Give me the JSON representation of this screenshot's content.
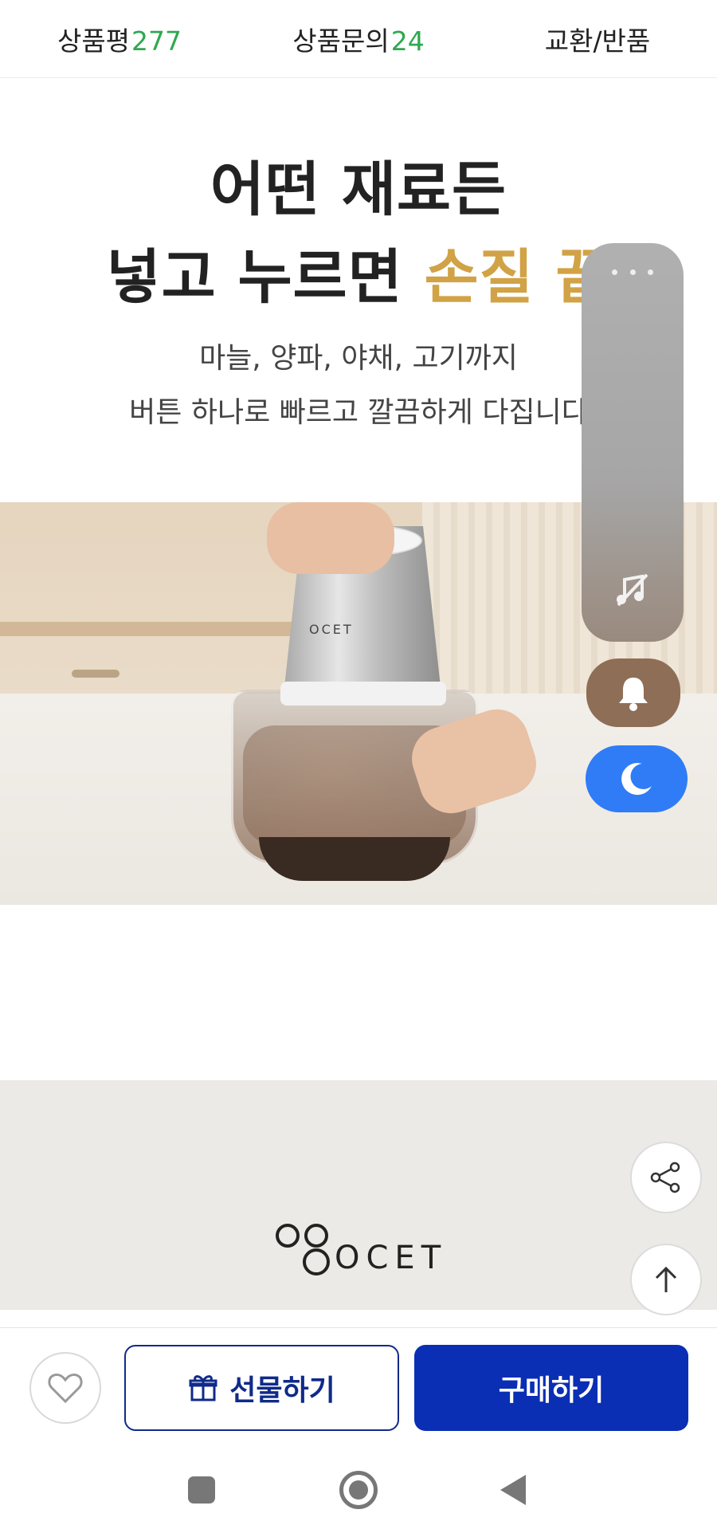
{
  "tabs": [
    {
      "label": "상품평",
      "count": "277"
    },
    {
      "label": "상품문의",
      "count": "24"
    },
    {
      "label": "교환/반품",
      "count": ""
    }
  ],
  "hero": {
    "headline_line1": "어떤 재료든",
    "headline_line2_prefix": "넣고 누르면 ",
    "headline_line2_highlight": "손질 끝",
    "sub_line1": "마늘, 양파, 야채, 고기까지",
    "sub_line2": "버튼 하나로 빠르고 깔끔하게 다집니다"
  },
  "photo": {
    "brand_mark": "OCET"
  },
  "brand_banner": {
    "logo_text": "OCET"
  },
  "floating": {
    "more": "more-icon",
    "music": "music-off-icon",
    "bell": "bell-icon",
    "moon": "moon-icon",
    "share": "share-icon",
    "top": "arrow-up-icon"
  },
  "buybar": {
    "gift_label": "선물하기",
    "buy_label": "구매하기"
  },
  "colors": {
    "accent_highlight": "#d1a246",
    "count_green": "#2fa84f",
    "buy_blue": "#0a2fb4",
    "moon_blue": "#2f7cf6"
  }
}
